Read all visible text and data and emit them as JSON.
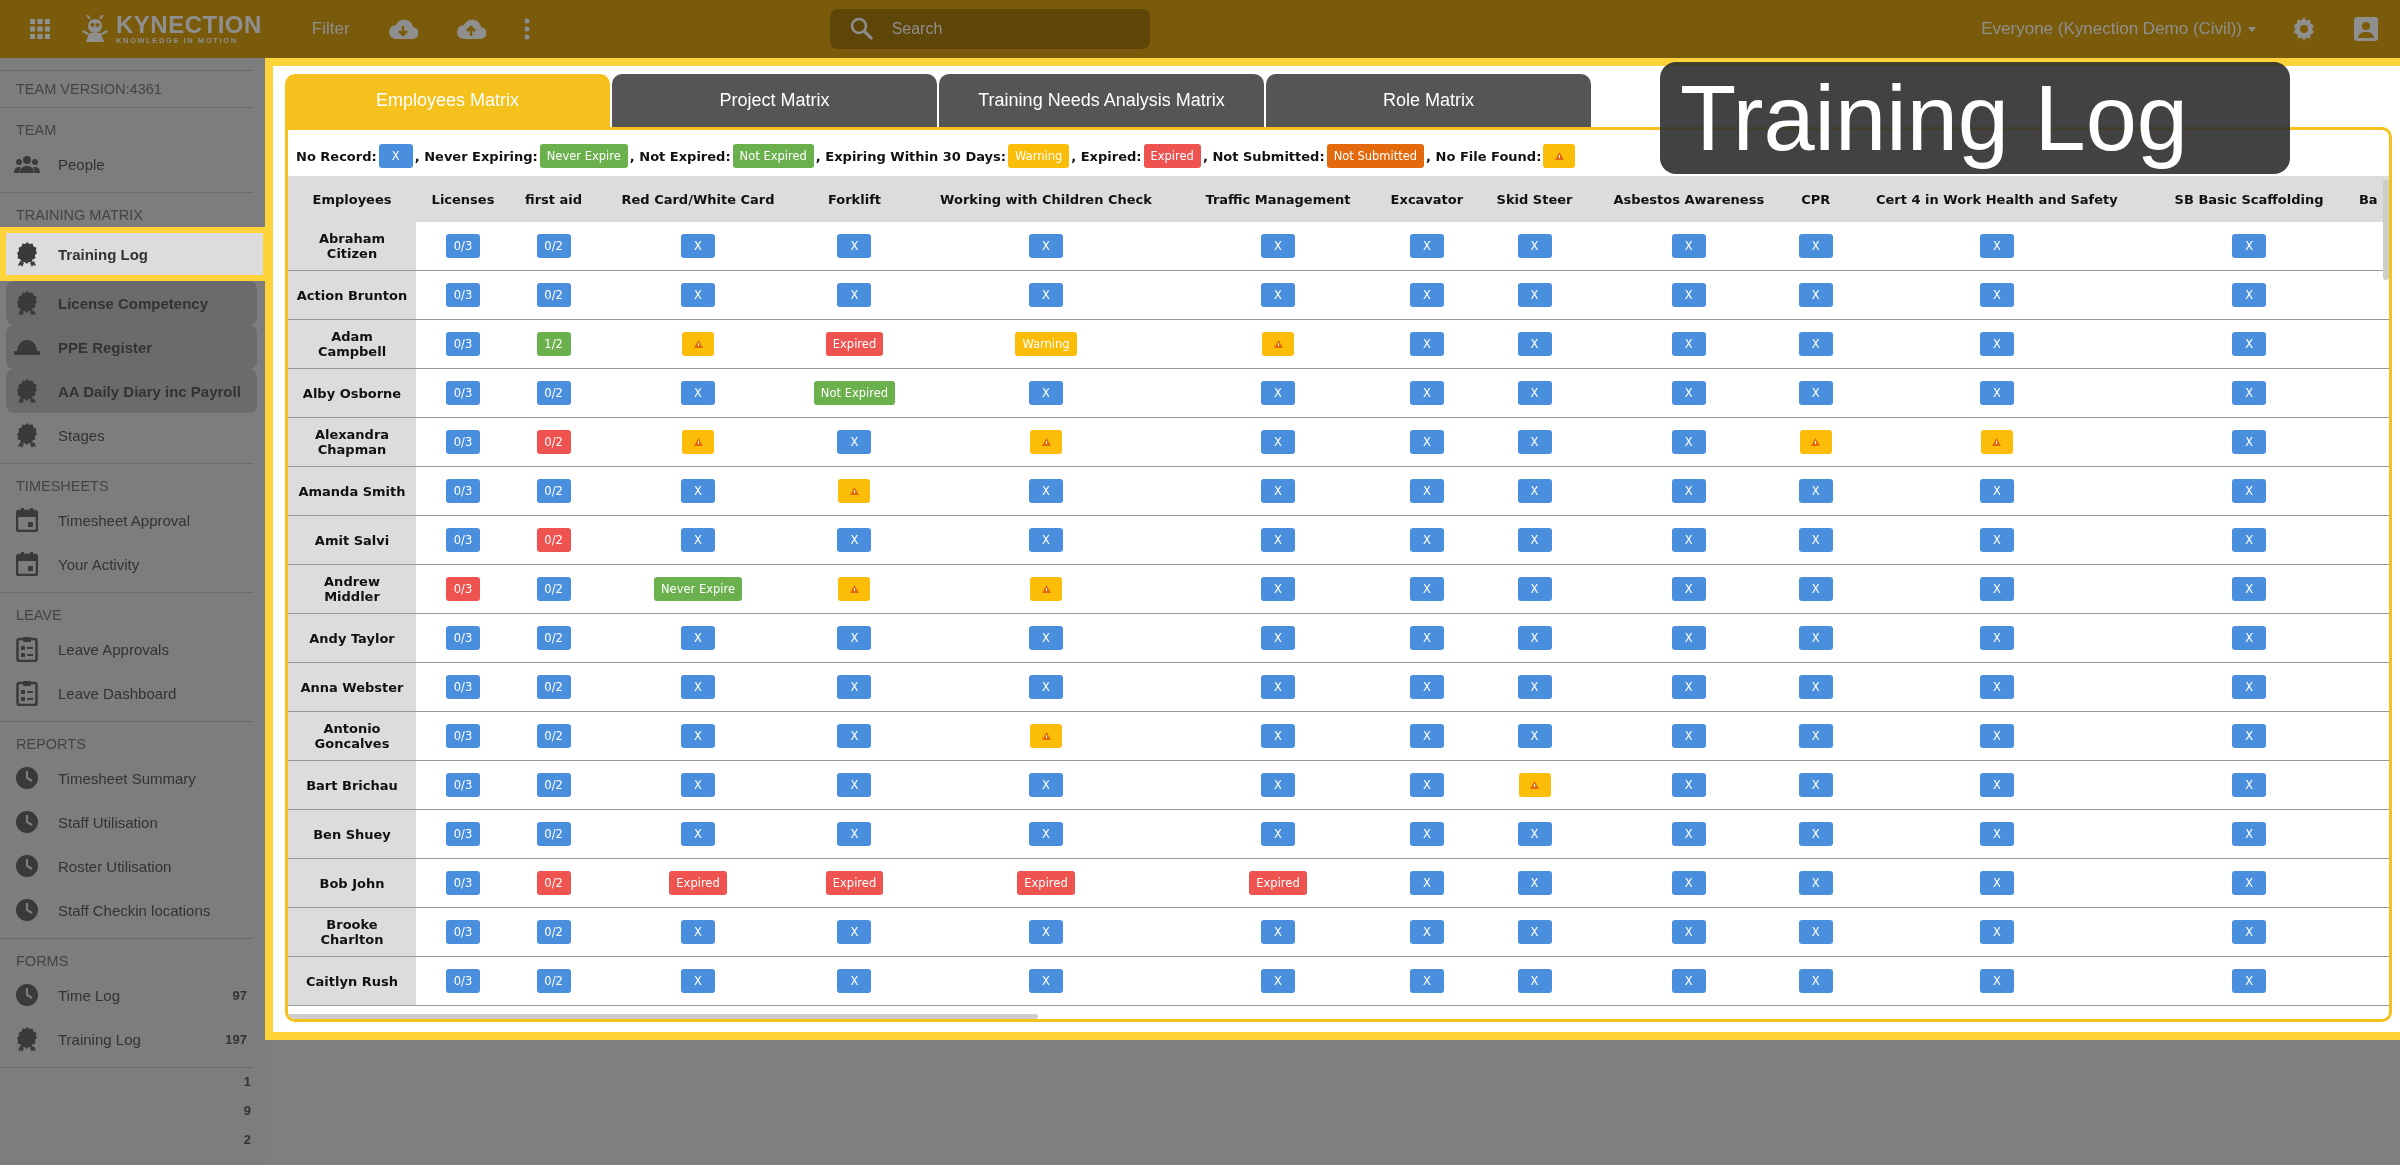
{
  "topbar": {
    "logo": {
      "name": "KYNECTION",
      "tagline": "KNOWLEDGE IN MOTION"
    },
    "filter": "Filter",
    "search": {
      "placeholder": "Search"
    },
    "account": "Everyone (Kynection Demo (Civil))"
  },
  "sidebar": {
    "version": "TEAM VERSION:4361",
    "sections": [
      {
        "title": "TEAM",
        "items": [
          {
            "label": "People",
            "kind": "people",
            "selected": false,
            "highlighted": false
          }
        ]
      },
      {
        "title": "TRAINING MATRIX",
        "items": [
          {
            "label": "Training Log",
            "kind": "award",
            "selected": true,
            "highlighted": false
          },
          {
            "label": "License Competency",
            "kind": "award",
            "selected": false,
            "highlighted": true
          },
          {
            "label": "PPE Register",
            "kind": "helmet",
            "selected": false,
            "highlighted": true
          },
          {
            "label": "AA Daily Diary inc Payroll",
            "kind": "award",
            "selected": false,
            "highlighted": true
          },
          {
            "label": "Stages",
            "kind": "award",
            "selected": false,
            "highlighted": false
          }
        ]
      },
      {
        "title": "TIMESHEETS",
        "items": [
          {
            "label": "Timesheet Approval",
            "kind": "calendar",
            "selected": false,
            "highlighted": false
          },
          {
            "label": "Your Activity",
            "kind": "calendar",
            "selected": false,
            "highlighted": false
          }
        ]
      },
      {
        "title": "LEAVE",
        "items": [
          {
            "label": "Leave Approvals",
            "kind": "clipboard",
            "selected": false,
            "highlighted": false
          },
          {
            "label": "Leave Dashboard",
            "kind": "clipboard",
            "selected": false,
            "highlighted": false
          }
        ]
      },
      {
        "title": "REPORTS",
        "items": [
          {
            "label": "Timesheet Summary",
            "kind": "clock",
            "selected": false,
            "highlighted": false
          },
          {
            "label": "Staff Utilisation",
            "kind": "clock",
            "selected": false,
            "highlighted": false
          },
          {
            "label": "Roster Utilisation",
            "kind": "clock",
            "selected": false,
            "highlighted": false
          },
          {
            "label": "Staff Checkin locations",
            "kind": "clock",
            "selected": false,
            "highlighted": false
          }
        ]
      },
      {
        "title": "FORMS",
        "items": [
          {
            "label": "Time Log",
            "kind": "clock",
            "selected": false,
            "highlighted": false,
            "count": "97"
          },
          {
            "label": "Training Log",
            "kind": "award",
            "selected": false,
            "highlighted": false,
            "count": "197"
          }
        ]
      }
    ],
    "counts": [
      "1",
      "9",
      "2"
    ]
  },
  "tabs": [
    {
      "label": "Employees Matrix",
      "selected": true
    },
    {
      "label": "Project Matrix",
      "selected": false
    },
    {
      "label": "Training Needs Analysis Matrix",
      "selected": false
    },
    {
      "label": "Role Matrix",
      "selected": false
    }
  ],
  "legend": [
    {
      "label": "No Record:",
      "kind": "none",
      "text": "X"
    },
    {
      "label": ", Never Expiring:",
      "kind": "never_expire",
      "text": "Never Expire"
    },
    {
      "label": ", Not Expired:",
      "kind": "not_expired",
      "text": "Not Expired"
    },
    {
      "label": ", Expiring Within 30 Days:",
      "kind": "warning",
      "text": "Warning"
    },
    {
      "label": ", Expired:",
      "kind": "expired",
      "text": "Expired"
    },
    {
      "label": ", Not Submitted:",
      "kind": "not_submitted",
      "text": "Not Submitted"
    },
    {
      "label": ", No File Found:",
      "kind": "no_file"
    }
  ],
  "table": {
    "columns": [
      "Employees",
      "Licenses",
      "first aid",
      "Red Card/White Card",
      "Forklift",
      "Working with Children Check",
      "Traffic Management",
      "Excavator",
      "Skid Steer",
      "Asbestos Awareness",
      "CPR",
      "Cert 4 in Work Health and Safety",
      "SB Basic Scaffolding",
      "Ba"
    ],
    "rows": [
      {
        "cells": [
          {
            "kind": "name",
            "text": "Abraham Citizen"
          },
          {
            "kind": "none",
            "text": "0/3"
          },
          {
            "kind": "none",
            "text": "0/2"
          },
          {
            "kind": "none",
            "text": "X"
          },
          {
            "kind": "none",
            "text": "X"
          },
          {
            "kind": "none",
            "text": "X"
          },
          {
            "kind": "none",
            "text": "X"
          },
          {
            "kind": "none",
            "text": "X"
          },
          {
            "kind": "none",
            "text": "X"
          },
          {
            "kind": "none",
            "text": "X"
          },
          {
            "kind": "none",
            "text": "X"
          },
          {
            "kind": "none",
            "text": "X"
          },
          {
            "kind": "none",
            "text": "X"
          }
        ]
      },
      {
        "cells": [
          {
            "kind": "name",
            "text": "Action Brunton"
          },
          {
            "kind": "none",
            "text": "0/3"
          },
          {
            "kind": "none",
            "text": "0/2"
          },
          {
            "kind": "none",
            "text": "X"
          },
          {
            "kind": "none",
            "text": "X"
          },
          {
            "kind": "none",
            "text": "X"
          },
          {
            "kind": "none",
            "text": "X"
          },
          {
            "kind": "none",
            "text": "X"
          },
          {
            "kind": "none",
            "text": "X"
          },
          {
            "kind": "none",
            "text": "X"
          },
          {
            "kind": "none",
            "text": "X"
          },
          {
            "kind": "none",
            "text": "X"
          },
          {
            "kind": "none",
            "text": "X"
          }
        ]
      },
      {
        "cells": [
          {
            "kind": "name",
            "text": "Adam Campbell"
          },
          {
            "kind": "none",
            "text": "0/3"
          },
          {
            "kind": "not_expired",
            "text": "1/2"
          },
          {
            "kind": "no_file"
          },
          {
            "kind": "expired",
            "text": "Expired"
          },
          {
            "kind": "warning",
            "text": "Warning"
          },
          {
            "kind": "no_file"
          },
          {
            "kind": "none",
            "text": "X"
          },
          {
            "kind": "none",
            "text": "X"
          },
          {
            "kind": "none",
            "text": "X"
          },
          {
            "kind": "none",
            "text": "X"
          },
          {
            "kind": "none",
            "text": "X"
          },
          {
            "kind": "none",
            "text": "X"
          }
        ]
      },
      {
        "cells": [
          {
            "kind": "name",
            "text": "Alby Osborne"
          },
          {
            "kind": "none",
            "text": "0/3"
          },
          {
            "kind": "none",
            "text": "0/2"
          },
          {
            "kind": "none",
            "text": "X"
          },
          {
            "kind": "not_expired",
            "text": "Not Expired"
          },
          {
            "kind": "none",
            "text": "X"
          },
          {
            "kind": "none",
            "text": "X"
          },
          {
            "kind": "none",
            "text": "X"
          },
          {
            "kind": "none",
            "text": "X"
          },
          {
            "kind": "none",
            "text": "X"
          },
          {
            "kind": "none",
            "text": "X"
          },
          {
            "kind": "none",
            "text": "X"
          },
          {
            "kind": "none",
            "text": "X"
          }
        ]
      },
      {
        "cells": [
          {
            "kind": "name",
            "text": "Alexandra Chapman"
          },
          {
            "kind": "none",
            "text": "0/3"
          },
          {
            "kind": "expired",
            "text": "0/2"
          },
          {
            "kind": "no_file"
          },
          {
            "kind": "none",
            "text": "X"
          },
          {
            "kind": "no_file"
          },
          {
            "kind": "none",
            "text": "X"
          },
          {
            "kind": "none",
            "text": "X"
          },
          {
            "kind": "none",
            "text": "X"
          },
          {
            "kind": "none",
            "text": "X"
          },
          {
            "kind": "no_file"
          },
          {
            "kind": "no_file"
          },
          {
            "kind": "none",
            "text": "X"
          }
        ]
      },
      {
        "cells": [
          {
            "kind": "name",
            "text": "Amanda Smith"
          },
          {
            "kind": "none",
            "text": "0/3"
          },
          {
            "kind": "none",
            "text": "0/2"
          },
          {
            "kind": "none",
            "text": "X"
          },
          {
            "kind": "no_file"
          },
          {
            "kind": "none",
            "text": "X"
          },
          {
            "kind": "none",
            "text": "X"
          },
          {
            "kind": "none",
            "text": "X"
          },
          {
            "kind": "none",
            "text": "X"
          },
          {
            "kind": "none",
            "text": "X"
          },
          {
            "kind": "none",
            "text": "X"
          },
          {
            "kind": "none",
            "text": "X"
          },
          {
            "kind": "none",
            "text": "X"
          }
        ]
      },
      {
        "cells": [
          {
            "kind": "name",
            "text": "Amit Salvi"
          },
          {
            "kind": "none",
            "text": "0/3"
          },
          {
            "kind": "expired",
            "text": "0/2"
          },
          {
            "kind": "none",
            "text": "X"
          },
          {
            "kind": "none",
            "text": "X"
          },
          {
            "kind": "none",
            "text": "X"
          },
          {
            "kind": "none",
            "text": "X"
          },
          {
            "kind": "none",
            "text": "X"
          },
          {
            "kind": "none",
            "text": "X"
          },
          {
            "kind": "none",
            "text": "X"
          },
          {
            "kind": "none",
            "text": "X"
          },
          {
            "kind": "none",
            "text": "X"
          },
          {
            "kind": "none",
            "text": "X"
          }
        ]
      },
      {
        "cells": [
          {
            "kind": "name",
            "text": "Andrew Middler"
          },
          {
            "kind": "expired",
            "text": "0/3"
          },
          {
            "kind": "none",
            "text": "0/2"
          },
          {
            "kind": "never_expire",
            "text": "Never Expire"
          },
          {
            "kind": "no_file"
          },
          {
            "kind": "no_file"
          },
          {
            "kind": "none",
            "text": "X"
          },
          {
            "kind": "none",
            "text": "X"
          },
          {
            "kind": "none",
            "text": "X"
          },
          {
            "kind": "none",
            "text": "X"
          },
          {
            "kind": "none",
            "text": "X"
          },
          {
            "kind": "none",
            "text": "X"
          },
          {
            "kind": "none",
            "text": "X"
          }
        ]
      },
      {
        "cells": [
          {
            "kind": "name",
            "text": "Andy Taylor"
          },
          {
            "kind": "none",
            "text": "0/3"
          },
          {
            "kind": "none",
            "text": "0/2"
          },
          {
            "kind": "none",
            "text": "X"
          },
          {
            "kind": "none",
            "text": "X"
          },
          {
            "kind": "none",
            "text": "X"
          },
          {
            "kind": "none",
            "text": "X"
          },
          {
            "kind": "none",
            "text": "X"
          },
          {
            "kind": "none",
            "text": "X"
          },
          {
            "kind": "none",
            "text": "X"
          },
          {
            "kind": "none",
            "text": "X"
          },
          {
            "kind": "none",
            "text": "X"
          },
          {
            "kind": "none",
            "text": "X"
          }
        ]
      },
      {
        "cells": [
          {
            "kind": "name",
            "text": "Anna Webster"
          },
          {
            "kind": "none",
            "text": "0/3"
          },
          {
            "kind": "none",
            "text": "0/2"
          },
          {
            "kind": "none",
            "text": "X"
          },
          {
            "kind": "none",
            "text": "X"
          },
          {
            "kind": "none",
            "text": "X"
          },
          {
            "kind": "none",
            "text": "X"
          },
          {
            "kind": "none",
            "text": "X"
          },
          {
            "kind": "none",
            "text": "X"
          },
          {
            "kind": "none",
            "text": "X"
          },
          {
            "kind": "none",
            "text": "X"
          },
          {
            "kind": "none",
            "text": "X"
          },
          {
            "kind": "none",
            "text": "X"
          }
        ]
      },
      {
        "cells": [
          {
            "kind": "name",
            "text": "Antonio Goncalves"
          },
          {
            "kind": "none",
            "text": "0/3"
          },
          {
            "kind": "none",
            "text": "0/2"
          },
          {
            "kind": "none",
            "text": "X"
          },
          {
            "kind": "none",
            "text": "X"
          },
          {
            "kind": "no_file"
          },
          {
            "kind": "none",
            "text": "X"
          },
          {
            "kind": "none",
            "text": "X"
          },
          {
            "kind": "none",
            "text": "X"
          },
          {
            "kind": "none",
            "text": "X"
          },
          {
            "kind": "none",
            "text": "X"
          },
          {
            "kind": "none",
            "text": "X"
          },
          {
            "kind": "none",
            "text": "X"
          }
        ]
      },
      {
        "cells": [
          {
            "kind": "name",
            "text": "Bart Brichau"
          },
          {
            "kind": "none",
            "text": "0/3"
          },
          {
            "kind": "none",
            "text": "0/2"
          },
          {
            "kind": "none",
            "text": "X"
          },
          {
            "kind": "none",
            "text": "X"
          },
          {
            "kind": "none",
            "text": "X"
          },
          {
            "kind": "none",
            "text": "X"
          },
          {
            "kind": "none",
            "text": "X"
          },
          {
            "kind": "no_file"
          },
          {
            "kind": "none",
            "text": "X"
          },
          {
            "kind": "none",
            "text": "X"
          },
          {
            "kind": "none",
            "text": "X"
          },
          {
            "kind": "none",
            "text": "X"
          }
        ]
      },
      {
        "cells": [
          {
            "kind": "name",
            "text": "Ben Shuey"
          },
          {
            "kind": "none",
            "text": "0/3"
          },
          {
            "kind": "none",
            "text": "0/2"
          },
          {
            "kind": "none",
            "text": "X"
          },
          {
            "kind": "none",
            "text": "X"
          },
          {
            "kind": "none",
            "text": "X"
          },
          {
            "kind": "none",
            "text": "X"
          },
          {
            "kind": "none",
            "text": "X"
          },
          {
            "kind": "none",
            "text": "X"
          },
          {
            "kind": "none",
            "text": "X"
          },
          {
            "kind": "none",
            "text": "X"
          },
          {
            "kind": "none",
            "text": "X"
          },
          {
            "kind": "none",
            "text": "X"
          }
        ]
      },
      {
        "cells": [
          {
            "kind": "name",
            "text": "Bob John"
          },
          {
            "kind": "none",
            "text": "0/3"
          },
          {
            "kind": "expired",
            "text": "0/2"
          },
          {
            "kind": "expired",
            "text": "Expired"
          },
          {
            "kind": "expired",
            "text": "Expired"
          },
          {
            "kind": "expired",
            "text": "Expired"
          },
          {
            "kind": "expired",
            "text": "Expired"
          },
          {
            "kind": "none",
            "text": "X"
          },
          {
            "kind": "none",
            "text": "X"
          },
          {
            "kind": "none",
            "text": "X"
          },
          {
            "kind": "none",
            "text": "X"
          },
          {
            "kind": "none",
            "text": "X"
          },
          {
            "kind": "none",
            "text": "X"
          }
        ]
      },
      {
        "cells": [
          {
            "kind": "name",
            "text": "Brooke Charlton"
          },
          {
            "kind": "none",
            "text": "0/3"
          },
          {
            "kind": "none",
            "text": "0/2"
          },
          {
            "kind": "none",
            "text": "X"
          },
          {
            "kind": "none",
            "text": "X"
          },
          {
            "kind": "none",
            "text": "X"
          },
          {
            "kind": "none",
            "text": "X"
          },
          {
            "kind": "none",
            "text": "X"
          },
          {
            "kind": "none",
            "text": "X"
          },
          {
            "kind": "none",
            "text": "X"
          },
          {
            "kind": "none",
            "text": "X"
          },
          {
            "kind": "none",
            "text": "X"
          },
          {
            "kind": "none",
            "text": "X"
          }
        ]
      },
      {
        "cells": [
          {
            "kind": "name",
            "text": "Caitlyn Rush"
          },
          {
            "kind": "none",
            "text": "0/3"
          },
          {
            "kind": "none",
            "text": "0/2"
          },
          {
            "kind": "none",
            "text": "X"
          },
          {
            "kind": "none",
            "text": "X"
          },
          {
            "kind": "none",
            "text": "X"
          },
          {
            "kind": "none",
            "text": "X"
          },
          {
            "kind": "none",
            "text": "X"
          },
          {
            "kind": "none",
            "text": "X"
          },
          {
            "kind": "none",
            "text": "X"
          },
          {
            "kind": "none",
            "text": "X"
          },
          {
            "kind": "none",
            "text": "X"
          },
          {
            "kind": "none",
            "text": "X"
          }
        ]
      }
    ]
  },
  "callout": {
    "title": "Training Log"
  }
}
